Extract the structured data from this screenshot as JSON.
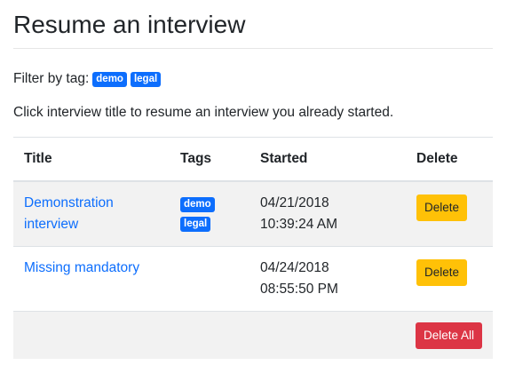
{
  "page": {
    "title": "Resume an interview"
  },
  "filter": {
    "label": "Filter by tag:",
    "tags": [
      "demo",
      "legal"
    ]
  },
  "hint": "Click interview title to resume an interview you already started.",
  "table": {
    "headers": {
      "title": "Title",
      "tags": "Tags",
      "started": "Started",
      "delete": "Delete"
    },
    "rows": [
      {
        "title": "Demonstration interview",
        "tags": [
          "demo",
          "legal"
        ],
        "date": "04/21/2018",
        "time": "10:39:24 AM",
        "delete_label": "Delete"
      },
      {
        "title": "Missing mandatory",
        "tags": [],
        "date": "04/24/2018",
        "time": "08:55:50 PM",
        "delete_label": "Delete"
      }
    ],
    "delete_all_label": "Delete All"
  },
  "colors": {
    "link": "#0d6efd",
    "tag": "#0d6efd",
    "warning": "#ffc107",
    "danger": "#dc3545"
  }
}
